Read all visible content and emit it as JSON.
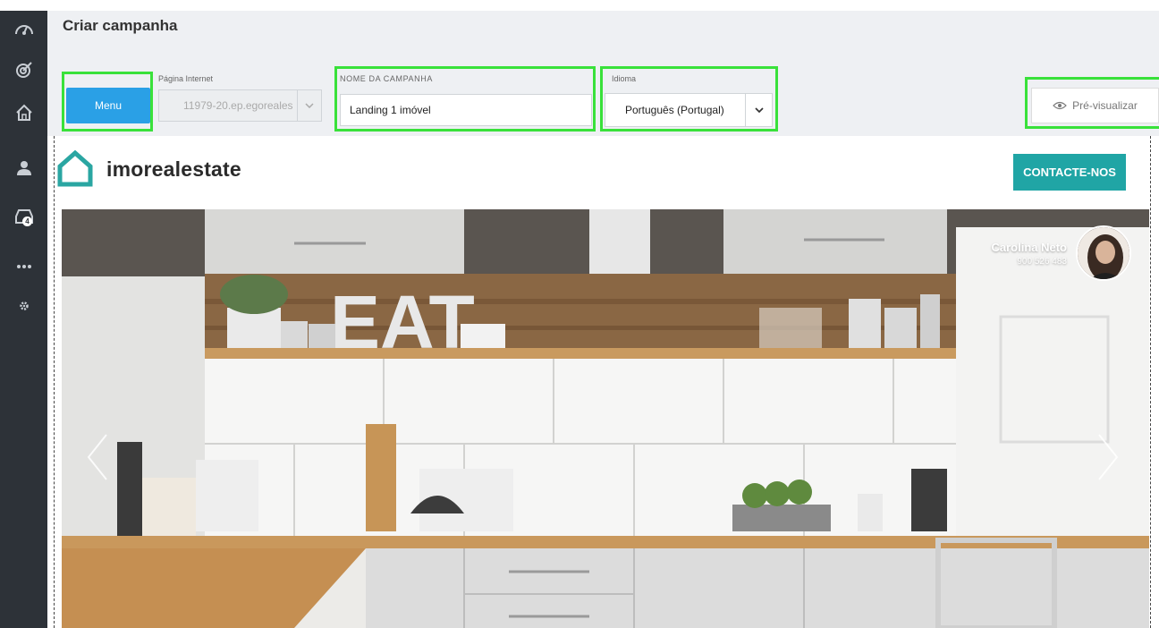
{
  "header": {
    "title": "Criar campanha",
    "menu_label": "Menu",
    "pagina_label": "Página Internet",
    "pagina_value": "11979-20.ep.egoreales",
    "campanha_label": "NOME DA CAMPANHA",
    "campanha_value": "Landing 1 imóvel",
    "idioma_label": "Idioma",
    "idioma_value": "Português (Portugal)",
    "preview_label": "Pré-visualizar"
  },
  "sidebar": {
    "items": [
      {
        "icon": "dashboard-gauge-icon"
      },
      {
        "icon": "target-icon"
      },
      {
        "icon": "home-icon"
      },
      {
        "icon": "user-icon"
      },
      {
        "icon": "inbox-icon",
        "badge": "4"
      },
      {
        "icon": "more-dots-icon"
      },
      {
        "icon": "gear-icon"
      }
    ]
  },
  "landing": {
    "brand": "imorealestate",
    "contact_label": "CONTACTE-NOS",
    "agent_name": "Carolina Neto",
    "agent_phone": "900 526 483",
    "hero_sign": "EAT"
  },
  "colors": {
    "sidebar": "#2d3238",
    "highlight": "#39e13a",
    "menu_button": "#2aa0e6",
    "accent_teal": "#20a5a5"
  }
}
